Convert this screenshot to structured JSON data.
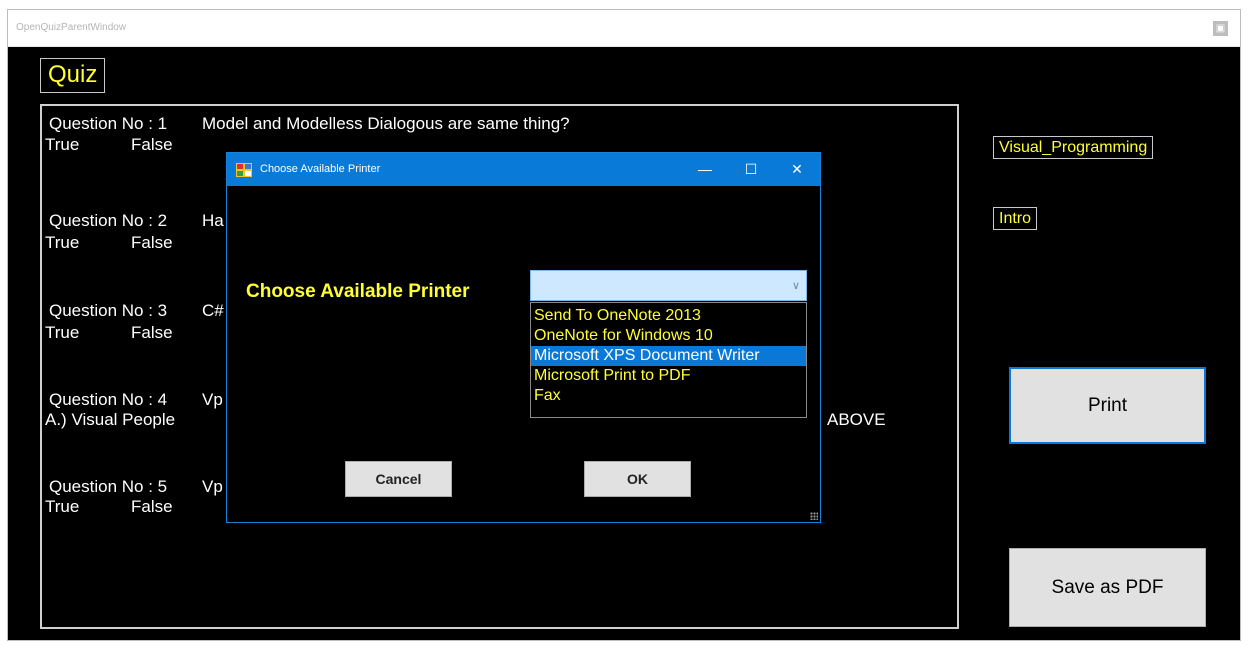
{
  "window": {
    "title": "OpenQuizParentWindow",
    "restore_glyph": "▣"
  },
  "quiz": {
    "header": "Quiz",
    "questions": [
      {
        "label": "Question No : 1",
        "text": "Model and Modelless Dialogous are same thing?",
        "answers": [
          "True",
          "False"
        ]
      },
      {
        "label": "Question No : 2",
        "text": "Ha",
        "answers": [
          "True",
          "False"
        ]
      },
      {
        "label": "Question No : 3",
        "text": "C#",
        "answers": [
          "True",
          "False"
        ]
      },
      {
        "label": "Question No : 4",
        "text": "Vp",
        "answers": [
          "A.) Visual People"
        ],
        "trailing_text": "ABOVE"
      },
      {
        "label": "Question No : 5",
        "text": "Vp",
        "answers": [
          "True",
          "False"
        ]
      }
    ]
  },
  "tags": {
    "subject": "Visual_Programming",
    "topic": "Intro"
  },
  "actions": {
    "print_label": "Print",
    "save_pdf_label": "Save as PDF"
  },
  "dialog": {
    "title": "Choose Available Printer",
    "minimize_glyph": "—",
    "maximize_glyph": "☐",
    "close_glyph": "✕",
    "label": "Choose Available Printer",
    "select_value": "",
    "chevron": "∨",
    "printers": [
      "Send To OneNote 2013",
      "OneNote for Windows 10",
      "Microsoft XPS Document Writer",
      "Microsoft Print to PDF",
      "Fax"
    ],
    "selected_index": 2,
    "cancel_label": "Cancel",
    "ok_label": "OK"
  },
  "colors": {
    "accent_yellow": "#ffff33",
    "titlebar_blue": "#0a7ad8",
    "selection_blue": "#0a78d7",
    "background": "#000000"
  }
}
